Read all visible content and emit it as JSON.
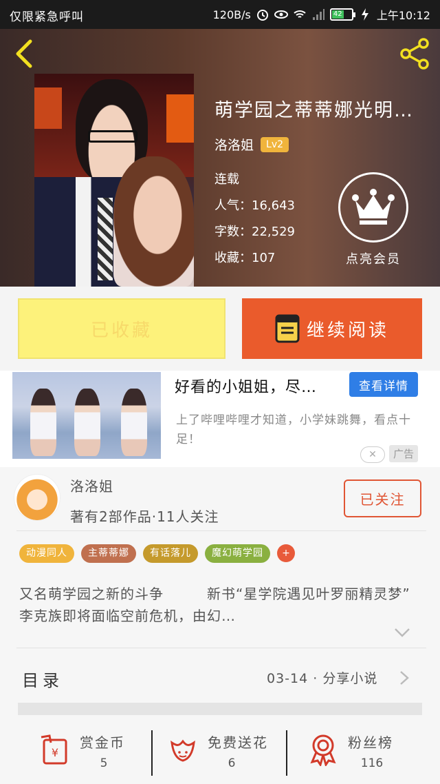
{
  "status_bar": {
    "carrier": "仅限紧急呼叫",
    "speed": "120B/s",
    "battery": "42",
    "time": "上午10:12"
  },
  "header": {
    "book_title": "萌学园之蒂蒂娜光明…",
    "author": "洛洛姐",
    "author_level": "Lv2",
    "status": "连载",
    "popularity_label": "人气：",
    "popularity": "16,643",
    "words_label": "字数：",
    "words": "22,529",
    "favorites_label": "收藏：",
    "favorites": "107",
    "vip_label": "点亮会员"
  },
  "actions": {
    "collected_label": "已收藏",
    "continue_label": "继续阅读"
  },
  "ad": {
    "title": "好看的小姐姐，尽…",
    "detail_button": "查看详情",
    "description": "上了哔哩哔哩才知道，小学妹跳舞，看点十足！",
    "label": "广告",
    "close": "✕"
  },
  "author_section": {
    "name": "洛洛姐",
    "info": "著有2部作品·11人关注",
    "follow_label": "已关注",
    "tags": [
      {
        "text": "动漫同人",
        "color": "#f0b43c"
      },
      {
        "text": "主蒂蒂娜",
        "color": "#c0704f"
      },
      {
        "text": "有话落儿",
        "color": "#c59a2c"
      },
      {
        "text": "魔幻萌学园",
        "color": "#8ab040"
      }
    ],
    "tag_more": "+",
    "intro": "又名萌学园之新的斗争　　　新书“星学院遇见叶罗丽精灵梦”　　　李克族即将面临空前危机，由幻…"
  },
  "catalog": {
    "title": "目录",
    "update": "03-14 · 分享小说"
  },
  "stats": [
    {
      "label": "赏金币",
      "value": "5",
      "icon": "red-envelope-icon"
    },
    {
      "label": "免费送花",
      "value": "6",
      "icon": "flower-icon"
    },
    {
      "label": "粉丝榜",
      "value": "116",
      "icon": "medal-icon"
    }
  ],
  "colors": {
    "accent_orange": "#ea5b2c",
    "collect_yellow": "#fdf27b",
    "detail_blue": "#2f7ee6"
  }
}
